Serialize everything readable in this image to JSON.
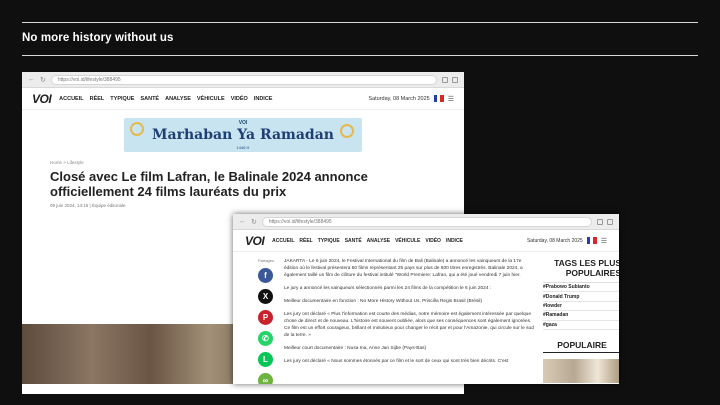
{
  "slide": {
    "title": "No more history without us"
  },
  "colors": {
    "background": "#0f0f0f",
    "rule": "#d8d8d8",
    "brand_blue": "#1f3f74"
  },
  "browser_back": {
    "url": "https://voi.id/lifestyle/388495",
    "site": {
      "logo": "VOI",
      "menu": [
        "ACCUEIL",
        "RÉEL",
        "TYPIQUE",
        "SANTÉ",
        "ANALYSE",
        "VÉHICULE",
        "VIDÉO",
        "INDICE"
      ],
      "date": "Saturday, 08 March 2025"
    },
    "banner": {
      "label": "VOI",
      "main": "Marhaban Ya Ramadan",
      "sub": "1446 H"
    },
    "breadcrumb": "Home  >  Lifestyle",
    "headline": "Closé avec Le film Lafran, le Balinale 2024 annonce officiellement 24 films lauréats du prix",
    "meta": "09 juin 2024, 13:16 | Équipe éditoriale"
  },
  "browser_front": {
    "url": "https://voi.id/lifestyle/388495",
    "site": {
      "logo": "VOI",
      "menu": [
        "ACCUEIL",
        "RÉEL",
        "TYPIQUE",
        "SANTÉ",
        "ANALYSE",
        "VÉHICULE",
        "VIDÉO",
        "INDICE"
      ],
      "date": "Saturday, 08 March 2025"
    },
    "share_label": "Partagez",
    "share_icons": [
      {
        "name": "facebook-icon",
        "glyph": "f",
        "color": "#3b5998"
      },
      {
        "name": "x-icon",
        "glyph": "X",
        "color": "#111111"
      },
      {
        "name": "pinterest-icon",
        "glyph": "P",
        "color": "#c8232c"
      },
      {
        "name": "whatsapp-icon",
        "glyph": "✆",
        "color": "#25d366"
      },
      {
        "name": "line-icon",
        "glyph": "L",
        "color": "#06c755"
      },
      {
        "name": "link-icon",
        "glyph": "∞",
        "color": "#6db33f"
      }
    ],
    "article": {
      "p1": "JAKARTA - Le 6 juin 2024, le Festival International du film de Bali (Balinale) a annoncé les vainqueurs de la 17e édition où le festival présentera 60 films représentant 25 pays sur plus de 600 titres enregistrés. Balinale 2024, a également taillé un film de clôture du festival intitulé \"World Premiere: Lafran, qui a été joué vendredi 7 juin hier.",
      "p2": "Le jury a annoncé les vainqueurs sélectionnés parmi les 24 films de la compétition le 6 juin 2024 :",
      "p3": "Meilleur documentaire en fonction : No More History Without Us, Priscilla Regis Brasil (Brésil)",
      "p4": "Les jury ont déclaré « Plus l'information est courte des médias, notre mémoire est également intéressée par quelque chose de direct et de nouveau. L'histoire est souvent oubliée, alors que ses conséquences sont également ignorées. Ce film est un effort courageux, brillant et minutieux pour changer le récit par et pour l'Amazonie, qui circule sur le sud de la terre. »",
      "p5": "Meilleur court documentaire : Nusa Ina, Anne Jan Sijbe (Pays-Bas)",
      "p6": "Les jury ont déclaré « Nous sommes étonnés par ce film et le sort de ceux qui sont très bien décrits. C'est"
    },
    "sidebar": {
      "tags_title": "TAGS LES PLUS POPULAIRES",
      "tags": [
        "#Prabowo Subianto",
        "#Donald Trump",
        "#lowder",
        "#Ramadan",
        "#gaza"
      ],
      "popular_title": "POPULAIRE"
    }
  }
}
